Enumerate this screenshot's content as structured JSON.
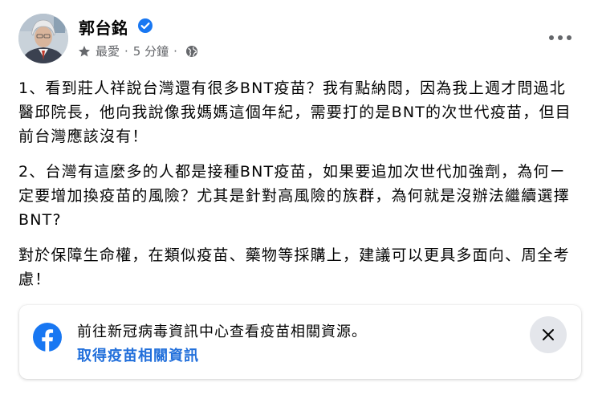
{
  "post": {
    "author": "郭台銘",
    "meta": {
      "favorite_label": "最愛",
      "separator": "·",
      "time": "5 分鐘",
      "separator2": "·"
    },
    "paragraphs": [
      "1、看到莊人祥說台灣還有很多BNT疫苗？我有點納悶，因為我上週才問過北醫邱院長，他向我說像我媽媽這個年紀，需要打的是BNT的次世代疫苗，但目前台灣應該沒有！",
      "2、台灣有這麼多的人都是接種BNT疫苗，如果要追加次世代加強劑，為何ㄧ定要增加換疫苗的風險？尤其是針對高風險的族群，為何就是沒辦法繼續選擇BNT?",
      "對於保障生命權，在類似疫苗、藥物等採購上，建議可以更具多面向、周全考慮！"
    ]
  },
  "banner": {
    "text": "前往新冠病毒資訊中心查看疫苗相關資源。",
    "link": "取得疫苗相關資訊"
  },
  "colors": {
    "brand_blue": "#1877f2",
    "link_blue": "#216fdb",
    "secondary_text": "#65676b",
    "close_bg": "#e4e6eb"
  },
  "icons": [
    "verified-badge-icon",
    "star-icon",
    "globe-icon",
    "more-options-icon",
    "facebook-logo-icon",
    "close-icon"
  ]
}
